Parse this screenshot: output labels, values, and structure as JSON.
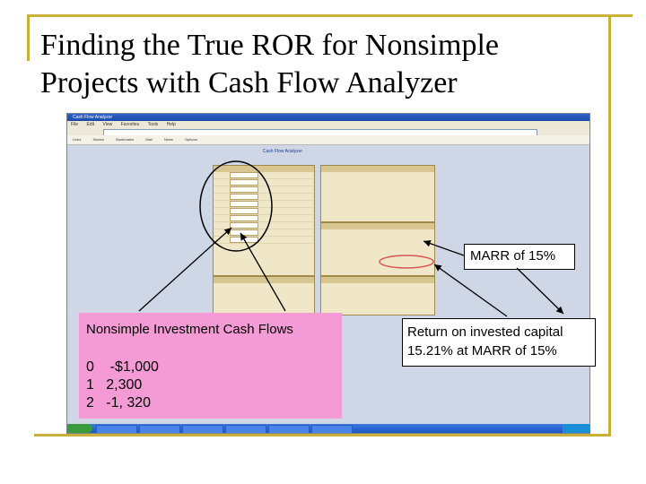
{
  "slide": {
    "title_line1": "Finding the True ROR for Nonsimple",
    "title_line2": "Projects with Cash Flow Analyzer"
  },
  "browser": {
    "window_title": "Cash Flow Analyzer",
    "menu": [
      "File",
      "Edit",
      "View",
      "Favorites",
      "Tools",
      "Help"
    ],
    "bookmarks": [
      "Links",
      "Search",
      "Bookmarks",
      "Mail",
      "News",
      "Options"
    ]
  },
  "app": {
    "header": "Cash Flow Analyzer"
  },
  "callouts": {
    "pink": {
      "title": "Nonsimple Investment Cash Flows",
      "rows": [
        "0    -$1,000",
        "1   2,300",
        "2   -1, 320"
      ]
    },
    "marr": "MARR of 15%",
    "ror_line1": "Return on invested capital",
    "ror_line2": "15.21% at MARR of 15%"
  },
  "colors": {
    "accent": "#c9b037",
    "pink": "#f49bd6",
    "highlight_ellipse": "#d9534f"
  }
}
